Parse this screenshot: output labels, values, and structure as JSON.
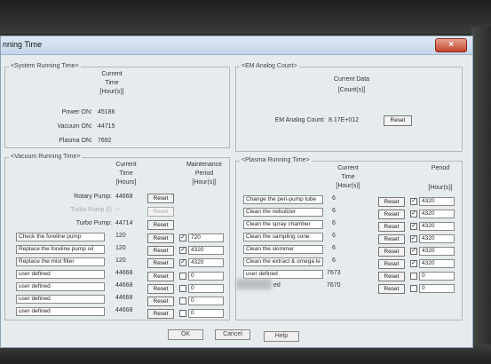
{
  "window": {
    "title": "nning Time",
    "close_label": "×"
  },
  "system_running_time": {
    "group_label": "<System Running Time>",
    "header": [
      "Current",
      "Time",
      "[Hour(s)]"
    ],
    "rows": [
      {
        "label": "Power ON:",
        "value": "45186"
      },
      {
        "label": "Vacuum ON:",
        "value": "44715"
      },
      {
        "label": "Plasma ON:",
        "value": "7692"
      }
    ]
  },
  "vacuum_running_time": {
    "group_label": "<Vacuum Running Time>",
    "header_current": [
      "Current",
      "Time",
      "[Hours]"
    ],
    "header_maint": [
      "Maintenance",
      "Period",
      "[Hour(s)]"
    ],
    "pump_rows": [
      {
        "label": "Rotary Pump:",
        "value": "44668",
        "reset": "Reset",
        "disabled": false
      },
      {
        "label": "Turbo Pump (I)",
        "value": "--",
        "reset": "Reset",
        "disabled": true
      },
      {
        "label": "Turbo Pump:",
        "value": "44714",
        "reset": "Reset",
        "disabled": false
      }
    ],
    "items": [
      {
        "name": "Check the foreline pump",
        "value": "120",
        "reset": "Reset",
        "checked": true,
        "period": "720"
      },
      {
        "name": "Replace the foreline pump oil",
        "value": "120",
        "reset": "Reset",
        "checked": true,
        "period": "4320"
      },
      {
        "name": "Replace the mist filter",
        "value": "120",
        "reset": "Reset",
        "checked": true,
        "period": "4320"
      },
      {
        "name": "user defined",
        "value": "44668",
        "reset": "Reset",
        "checked": false,
        "period": "0"
      },
      {
        "name": "user defined",
        "value": "44668",
        "reset": "Reset",
        "checked": false,
        "period": "0"
      },
      {
        "name": "user defined",
        "value": "44668",
        "reset": "Reset",
        "checked": false,
        "period": "0"
      },
      {
        "name": "user defined",
        "value": "44668",
        "reset": "Reset",
        "checked": false,
        "period": "0"
      }
    ]
  },
  "em_analog_count": {
    "group_label": "<EM Analog Count>",
    "header": [
      "Current Data",
      "[Count(s)]"
    ],
    "label": "EM Analog Count:",
    "value": "8.17E+012",
    "reset": "Reset"
  },
  "plasma_running_time": {
    "group_label": "<Plasma Running Time>",
    "header_current": [
      "Current",
      "Time",
      "[Hour(s)]"
    ],
    "header_period": [
      "Period",
      "[Hour(s)]"
    ],
    "items": [
      {
        "name": "Change the peri-pump tube",
        "value": "6",
        "reset": "Reset",
        "checked": true,
        "period": "4320"
      },
      {
        "name": "Clean the nebulizer",
        "value": "6",
        "reset": "Reset",
        "checked": true,
        "period": "4320"
      },
      {
        "name": "Clean the spray chamber",
        "value": "6",
        "reset": "Reset",
        "checked": true,
        "period": "4320"
      },
      {
        "name": "Clean the sampling cone",
        "value": "6",
        "reset": "Reset",
        "checked": true,
        "period": "4320"
      },
      {
        "name": "Clean the skimmer",
        "value": "6",
        "reset": "Reset",
        "checked": true,
        "period": "4320"
      },
      {
        "name": "Clean the extract & omega le",
        "value": "6",
        "reset": "Reset",
        "checked": true,
        "period": "4320"
      },
      {
        "name": "user defined",
        "value": "7673",
        "reset": "Reset",
        "checked": false,
        "period": "0"
      },
      {
        "name": "ed",
        "value": "7670",
        "reset": "Reset",
        "checked": false,
        "period": "0"
      }
    ]
  },
  "footer": {
    "ok": "OK",
    "cancel": "Cancel",
    "help": "Help"
  },
  "colors": {
    "window_bg": "#e6ebee",
    "titlebar": "#c4d6ea",
    "close": "#c4452c"
  }
}
